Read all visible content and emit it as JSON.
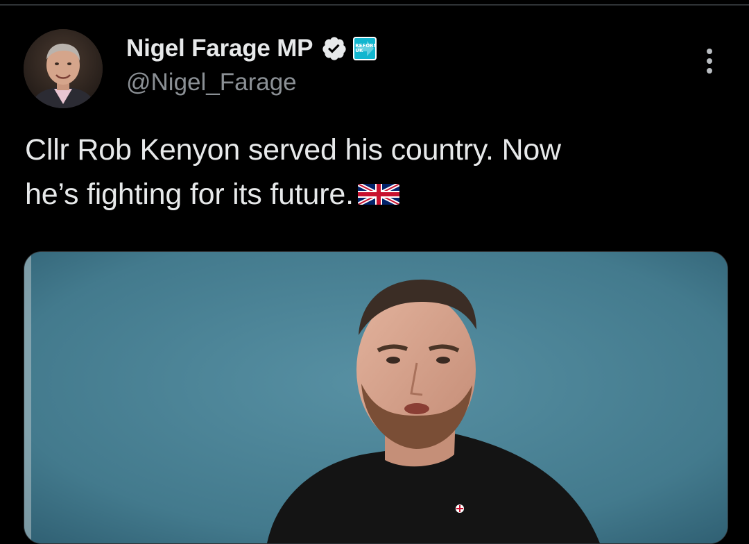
{
  "tweet": {
    "author": {
      "display_name": "Nigel Farage MP",
      "handle": "@Nigel_Farage",
      "verified": true,
      "verified_icon": "verified-badge-icon",
      "affiliate_badge_icon": "reform-uk-badge-icon",
      "affiliate_badge_text": "REFORM UK",
      "avatar_icon": "profile-avatar"
    },
    "text_line_1": "Cllr Rob Kenyon served his country. Now",
    "text_line_2": "he’s fighting for its future.",
    "emoji_icon": "union-jack-flag-icon",
    "media": {
      "type": "photo",
      "description_icon": "man-in-black-tshirt-photo"
    },
    "more_icon": "more-options-icon"
  },
  "colors": {
    "background": "#000000",
    "text_primary": "#e7e9ea",
    "text_secondary": "#8b9095",
    "verified_blue": "#1d9bf0",
    "reform_cyan": "#12b6cf",
    "media_backdrop": "#477f92"
  }
}
